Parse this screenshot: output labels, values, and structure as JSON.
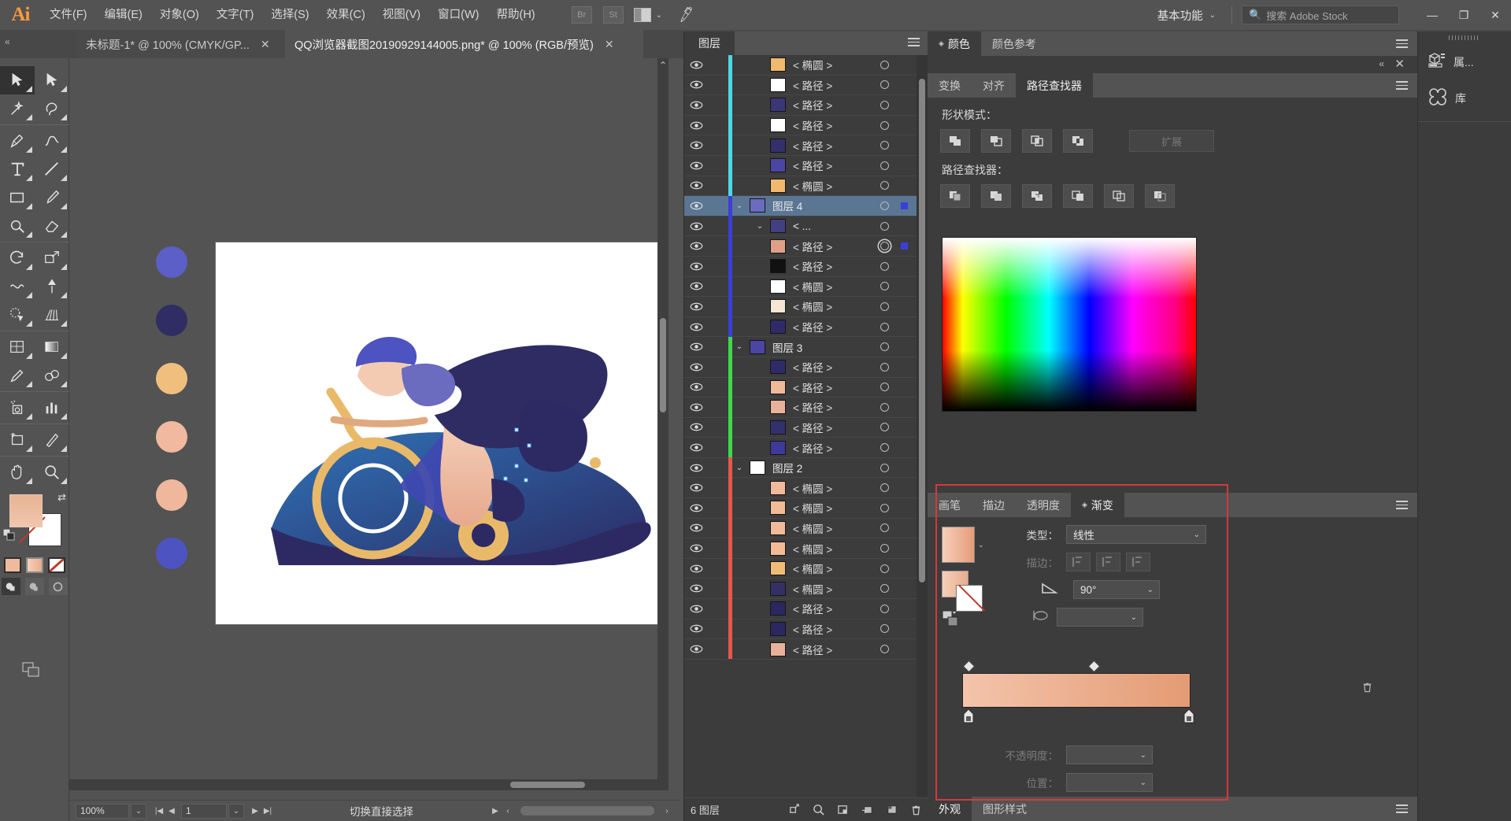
{
  "app": {
    "logo": "Ai",
    "menus": [
      "文件(F)",
      "编辑(E)",
      "对象(O)",
      "文字(T)",
      "选择(S)",
      "效果(C)",
      "视图(V)",
      "窗口(W)",
      "帮助(H)"
    ],
    "bridge_button": "Br",
    "stock_button": "St",
    "workspace": "基本功能",
    "search_placeholder": "搜索 Adobe Stock",
    "window_controls": {
      "minimize": "—",
      "restore": "❐",
      "close": "✕"
    }
  },
  "tabs": [
    {
      "title": "未标题-1* @ 100% (CMYK/GP...",
      "active": false,
      "close": "✕"
    },
    {
      "title": "QQ浏览器截图20190929144005.png* @ 100% (RGB/预览)",
      "active": true,
      "close": "✕"
    }
  ],
  "toolbar": {
    "tools": [
      {
        "name": "selection-tool",
        "sel": true
      },
      {
        "name": "direct-selection-tool",
        "sel": false
      },
      {
        "name": "magic-wand-tool",
        "sel": false
      },
      {
        "name": "lasso-tool",
        "sel": false
      },
      {
        "name": "pen-tool",
        "sel": false
      },
      {
        "name": "curvature-tool",
        "sel": false
      },
      {
        "name": "type-tool",
        "sel": false
      },
      {
        "name": "line-segment-tool",
        "sel": false
      },
      {
        "name": "rectangle-tool",
        "sel": false
      },
      {
        "name": "paintbrush-tool",
        "sel": false
      },
      {
        "name": "shaper-tool",
        "sel": false
      },
      {
        "name": "eraser-tool",
        "sel": false
      },
      {
        "name": "rotate-tool",
        "sel": false
      },
      {
        "name": "scale-tool",
        "sel": false
      },
      {
        "name": "width-tool",
        "sel": false
      },
      {
        "name": "free-transform-tool",
        "sel": false
      },
      {
        "name": "shape-builder-tool",
        "sel": false
      },
      {
        "name": "perspective-grid-tool",
        "sel": false
      },
      {
        "name": "mesh-tool",
        "sel": false
      },
      {
        "name": "gradient-tool",
        "sel": false
      },
      {
        "name": "eyedropper-tool",
        "sel": false
      },
      {
        "name": "blend-tool",
        "sel": false
      },
      {
        "name": "symbol-sprayer-tool",
        "sel": false
      },
      {
        "name": "column-graph-tool",
        "sel": false
      },
      {
        "name": "artboard-tool",
        "sel": false
      },
      {
        "name": "slice-tool",
        "sel": false
      },
      {
        "name": "hand-tool",
        "sel": false
      },
      {
        "name": "zoom-tool",
        "sel": false
      }
    ],
    "fill_color": "#eeb597",
    "stroke_color": "#ffffff",
    "none_color": "#ffffff"
  },
  "canvas": {
    "artboard_background": "#ffffff",
    "palette_dots": [
      {
        "color": "#5b5fc7"
      },
      {
        "color": "#2f2d63"
      },
      {
        "color": "#f0bf7e"
      },
      {
        "color": "#f0b9a0"
      },
      {
        "color": "#efb79b"
      },
      {
        "color": "#4d53c0"
      }
    ],
    "illustration": "cyclist-on-bicycle-flat-illustration"
  },
  "statusbar": {
    "zoom": "100%",
    "page": "1",
    "tool_status": "切换直接选择"
  },
  "layers_panel": {
    "title": "图层",
    "count_label": "6 图层",
    "footer_icons": [
      "clipping-mask-icon",
      "make-selection-icon",
      "new-sublayer-icon",
      "new-layer-icon",
      "delete-layer-icon"
    ],
    "rows": [
      {
        "name": "< 椭圆 >",
        "indent": 1,
        "color": "#4ad9e4",
        "thumb": "#f0b96e",
        "kind": "ellipse",
        "selected": false,
        "target": "plain"
      },
      {
        "name": "< 路径 >",
        "indent": 1,
        "color": "#4ad9e4",
        "thumb": "#ffffff",
        "kind": "path",
        "selected": false,
        "target": "plain"
      },
      {
        "name": "< 路径 >",
        "indent": 1,
        "color": "#4ad9e4",
        "thumb": "#3b3676",
        "kind": "path",
        "selected": false,
        "target": "plain"
      },
      {
        "name": "< 路径 >",
        "indent": 1,
        "color": "#4ad9e4",
        "thumb": "#ffffff",
        "kind": "path",
        "selected": false,
        "target": "plain"
      },
      {
        "name": "< 路径 >",
        "indent": 1,
        "color": "#4ad9e4",
        "thumb": "#34306c",
        "kind": "path",
        "selected": false,
        "target": "plain"
      },
      {
        "name": "< 路径 >",
        "indent": 1,
        "color": "#4ad9e4",
        "thumb": "#4b46a3",
        "kind": "path",
        "selected": false,
        "target": "plain"
      },
      {
        "name": "< 椭圆 >",
        "indent": 1,
        "color": "#4ad9e4",
        "thumb": "#f0b96e",
        "kind": "ellipse",
        "selected": false,
        "target": "plain"
      },
      {
        "name": "图层 4",
        "indent": 0,
        "color": "#3b3fd8",
        "thumb": "#6b6bc0",
        "kind": "group",
        "selected": true,
        "target": "plain",
        "expanded": true
      },
      {
        "name": "< ...",
        "indent": 1,
        "color": "#3b3fd8",
        "thumb": "#42407f",
        "kind": "group",
        "selected": false,
        "target": "plain"
      },
      {
        "name": "< 路径 >",
        "indent": 1,
        "color": "#3b3fd8",
        "thumb": "#e0a088",
        "kind": "path",
        "selected": false,
        "target": "double"
      },
      {
        "name": "< 路径 >",
        "indent": 1,
        "color": "#3b3fd8",
        "thumb": "#111111",
        "kind": "path",
        "selected": false,
        "target": "plain"
      },
      {
        "name": "< 椭圆 >",
        "indent": 1,
        "color": "#3b3fd8",
        "thumb": "#ffffff",
        "kind": "ellipse",
        "selected": false,
        "target": "plain"
      },
      {
        "name": "< 椭圆 >",
        "indent": 1,
        "color": "#3b3fd8",
        "thumb": "#f4e5d4",
        "kind": "ellipse",
        "selected": false,
        "target": "plain"
      },
      {
        "name": "< 路径 >",
        "indent": 1,
        "color": "#3b3fd8",
        "thumb": "#2f2b66",
        "kind": "path",
        "selected": false,
        "target": "plain"
      },
      {
        "name": "图层 3",
        "indent": 0,
        "color": "#3ddb4a",
        "thumb": "#4b46a3",
        "kind": "group",
        "selected": false,
        "target": "plain",
        "expanded": true
      },
      {
        "name": "< 路径 >",
        "indent": 1,
        "color": "#3ddb4a",
        "thumb": "#2f2b66",
        "kind": "path",
        "selected": false,
        "target": "plain"
      },
      {
        "name": "< 路径 >",
        "indent": 1,
        "color": "#3ddb4a",
        "thumb": "#f0b99a",
        "kind": "path",
        "selected": false,
        "target": "plain"
      },
      {
        "name": "< 路径 >",
        "indent": 1,
        "color": "#3ddb4a",
        "thumb": "#e8b29a",
        "kind": "path",
        "selected": false,
        "target": "plain"
      },
      {
        "name": "< 路径 >",
        "indent": 1,
        "color": "#3ddb4a",
        "thumb": "#33306e",
        "kind": "path",
        "selected": false,
        "target": "plain"
      },
      {
        "name": "< 路径 >",
        "indent": 1,
        "color": "#3ddb4a",
        "thumb": "#3f3a9a",
        "kind": "path",
        "selected": false,
        "target": "plain"
      },
      {
        "name": "图层 2",
        "indent": 0,
        "color": "#e8574c",
        "thumb": "#ffffff",
        "kind": "group",
        "selected": false,
        "target": "plain",
        "expanded": true
      },
      {
        "name": "< 椭圆 >",
        "indent": 1,
        "color": "#e8574c",
        "thumb": "#f0b99a",
        "kind": "ellipse",
        "selected": false,
        "target": "plain"
      },
      {
        "name": "< 椭圆 >",
        "indent": 1,
        "color": "#e8574c",
        "thumb": "#f2bb96",
        "kind": "ellipse",
        "selected": false,
        "target": "plain"
      },
      {
        "name": "< 椭圆 >",
        "indent": 1,
        "color": "#e8574c",
        "thumb": "#f0b99a",
        "kind": "ellipse",
        "selected": false,
        "target": "plain"
      },
      {
        "name": "< 椭圆 >",
        "indent": 1,
        "color": "#e8574c",
        "thumb": "#f2bb96",
        "kind": "ellipse",
        "selected": false,
        "target": "plain"
      },
      {
        "name": "< 椭圆 >",
        "indent": 1,
        "color": "#e8574c",
        "thumb": "#f0bd78",
        "kind": "ellipse",
        "selected": false,
        "target": "plain"
      },
      {
        "name": "< 椭圆 >",
        "indent": 1,
        "color": "#e8574c",
        "thumb": "#343064",
        "kind": "ellipse",
        "selected": false,
        "target": "plain"
      },
      {
        "name": "< 路径 >",
        "indent": 1,
        "color": "#e8574c",
        "thumb": "#2b2760",
        "kind": "path",
        "selected": false,
        "target": "plain"
      },
      {
        "name": "< 路径 >",
        "indent": 1,
        "color": "#e8574c",
        "thumb": "#2b2760",
        "kind": "path",
        "selected": false,
        "target": "plain"
      },
      {
        "name": "< 路径 >",
        "indent": 1,
        "color": "#e8574c",
        "thumb": "#e8b29a",
        "kind": "path",
        "selected": false,
        "target": "plain"
      }
    ]
  },
  "color_panel": {
    "tabs": [
      {
        "label": "颜色",
        "active": true,
        "grip": true
      },
      {
        "label": "颜色参考",
        "active": false,
        "grip": false
      }
    ]
  },
  "pathfinder_panel": {
    "tabs": [
      {
        "label": "变换",
        "active": false
      },
      {
        "label": "对齐",
        "active": false
      },
      {
        "label": "路径查找器",
        "active": true
      }
    ],
    "shape_modes_label": "形状模式：",
    "pathfinder_label": "路径查找器：",
    "expand_button": "扩展",
    "shape_mode_buttons": [
      "unite-icon",
      "minus-front-icon",
      "intersect-icon",
      "exclude-icon"
    ],
    "pathfinder_buttons": [
      "divide-icon",
      "trim-icon",
      "merge-icon",
      "crop-icon",
      "outline-icon",
      "minus-back-icon"
    ]
  },
  "gradient_panel": {
    "tabs": [
      {
        "label": "画笔",
        "active": false,
        "grip": false
      },
      {
        "label": "描边",
        "active": false,
        "grip": false
      },
      {
        "label": "透明度",
        "active": false,
        "grip": false
      },
      {
        "label": "渐变",
        "active": true,
        "grip": true
      }
    ],
    "type_label": "类型：",
    "type_value": "线性",
    "stroke_label": "描边：",
    "angle_value": "90°",
    "opacity_label": "不透明度：",
    "opacity_value": "",
    "location_label": "位置：",
    "location_value": "",
    "gradient_start": "#f3c4ab",
    "gradient_end": "#e49b74",
    "highlight_color": "#d33a3a"
  },
  "appearance_panel": {
    "tabs": [
      {
        "label": "外观",
        "active": true
      },
      {
        "label": "图形样式",
        "active": false
      }
    ]
  },
  "rail": {
    "items": [
      {
        "label": "属...",
        "icon": "properties-icon"
      },
      {
        "label": "库",
        "icon": "libraries-icon"
      }
    ]
  }
}
